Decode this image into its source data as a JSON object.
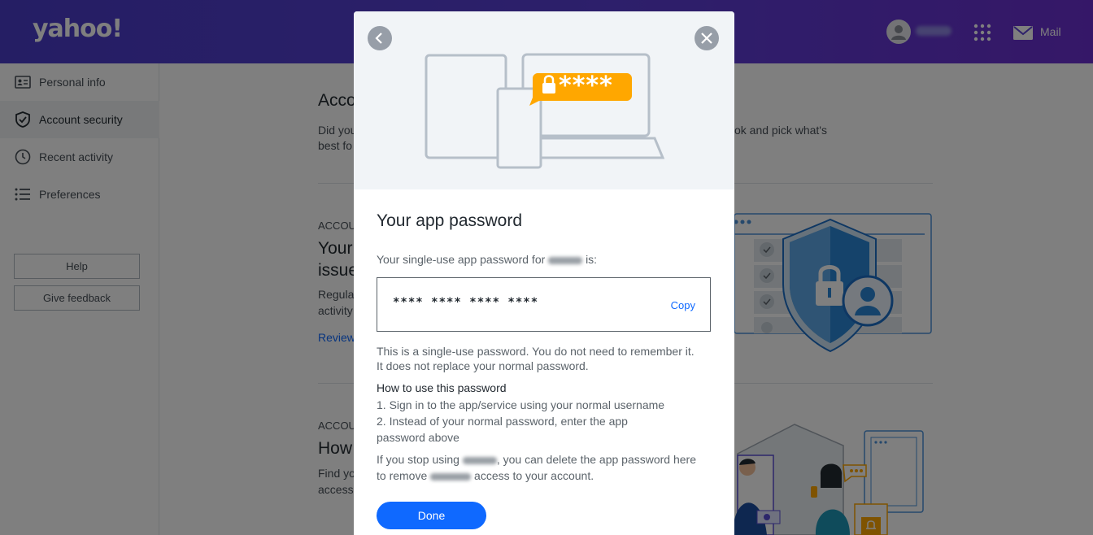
{
  "header": {
    "logo": "yahoo!",
    "mail_label": "Mail"
  },
  "sidebar": {
    "items": [
      {
        "label": "Personal info",
        "icon": "id-card-icon"
      },
      {
        "label": "Account security",
        "icon": "shield-check-icon",
        "active": true
      },
      {
        "label": "Recent activity",
        "icon": "clock-icon"
      },
      {
        "label": "Preferences",
        "icon": "list-icon"
      }
    ],
    "help_label": "Help",
    "feedback_label": "Give feedback"
  },
  "page": {
    "title_fragment": "Acco",
    "intro_line1": "Did you",
    "intro_line1_right": "ok and pick what's",
    "intro_line2": "best fo",
    "sec1_caption": "ACCOU",
    "sec1_heading_l1": "Your",
    "sec1_heading_l2": "issue",
    "sec1_body_l1": "Regula",
    "sec1_body_l2": "activity",
    "sec1_link": "Review",
    "sec2_caption": "ACCOU",
    "sec2_heading": "How",
    "sec2_body_l1": "Find yo",
    "sec2_body_l2": "access"
  },
  "modal": {
    "title": "Your app password",
    "intro_prefix": "Your single-use app password for",
    "intro_suffix": "is:",
    "password": "****  ****  ****  ****",
    "copy_label": "Copy",
    "note_line1": "This is a single-use password. You do not need to remember it.",
    "note_line2": "It does not replace your normal password.",
    "howto_heading": "How to use this password",
    "step1": "1. Sign in to the app/service using your normal username",
    "step2_line1": "2. Instead of your normal password, enter the app",
    "step2_line2": "password above",
    "stop_prefix": "If you stop using",
    "stop_suffix": ", you can delete the app password here",
    "remove_prefix": "to remove",
    "remove_suffix": "access to your account.",
    "done_label": "Done",
    "badge_text": "****"
  },
  "colors": {
    "header_gradient_start": "#4a3dc9",
    "header_gradient_end": "#6b2fd0",
    "primary_blue": "#0f69ff",
    "badge_orange": "#ffa700"
  }
}
